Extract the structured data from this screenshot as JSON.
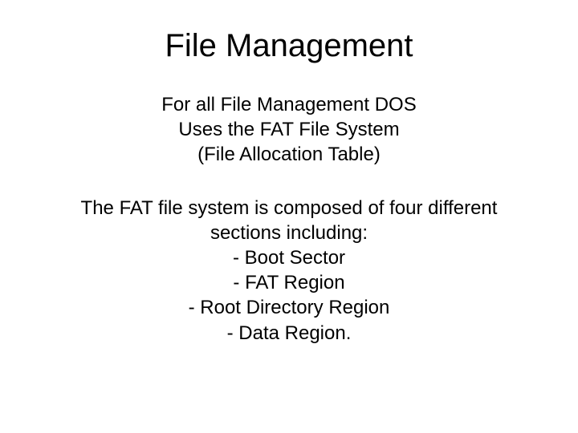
{
  "title": "File Management",
  "intro": {
    "line1": "For all File Management DOS",
    "line2": "Uses the FAT  File System",
    "line3": "(File Allocation Table)"
  },
  "body": {
    "line1": "The FAT file system is composed of four different",
    "line2": "sections including:",
    "line3": "- Boot Sector",
    "line4": "-  FAT Region",
    "line5": "-  Root Directory Region",
    "line6": "-  Data Region."
  }
}
